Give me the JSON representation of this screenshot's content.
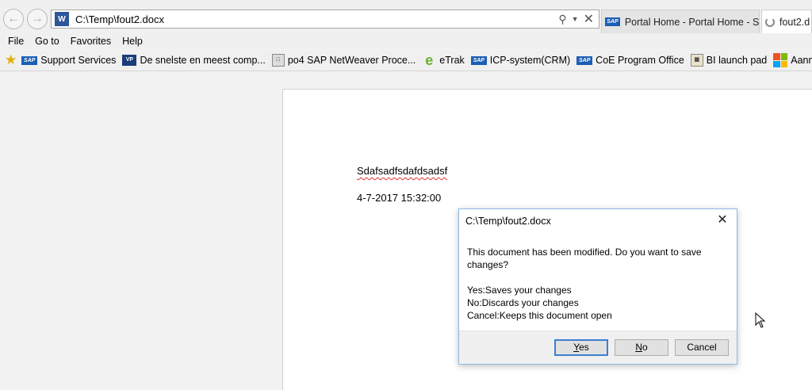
{
  "browser": {
    "address": "C:\\Temp\\fout2.docx",
    "address_icon": "W",
    "tabs": [
      {
        "label": "Portal Home - Portal Home - S...",
        "icon": "sap-logo-icon"
      },
      {
        "label": "fout2.d",
        "icon": "loading-spinner-icon"
      }
    ]
  },
  "menu": [
    "File",
    "Go to",
    "Favorites",
    "Help"
  ],
  "favorites": [
    {
      "label": "Support Services",
      "icon": "SAP"
    },
    {
      "label": "De snelste en meest comp...",
      "icon": "VP"
    },
    {
      "label": "po4 SAP NetWeaver Proce...",
      "icon": "page-icon"
    },
    {
      "label": "eTrak",
      "icon": "e"
    },
    {
      "label": "ICP-system(CRM)",
      "icon": "SAP"
    },
    {
      "label": "CoE Program Office",
      "icon": "SAP"
    },
    {
      "label": "BI launch pad",
      "icon": "bi-icon"
    },
    {
      "label": "Aanmelden bij je",
      "icon": "ms-icon"
    }
  ],
  "document": {
    "line1": "Sdafsadfsdafdsadsf",
    "line2": "4-7-2017 15:32:00"
  },
  "dialog": {
    "title": "C:\\Temp\\fout2.docx",
    "message": "This document has been modified. Do you want to save changes?",
    "options": [
      "Yes:Saves your changes",
      "No:Discards your changes",
      "Cancel:Keeps this document open"
    ],
    "buttons": {
      "yes_u": "Y",
      "yes_rest": "es",
      "no_u": "N",
      "no_rest": "o",
      "cancel": "Cancel"
    }
  },
  "colors": {
    "accent": "#3c7fd1",
    "dialog_border": "#8fb8e6",
    "sap_blue": "#1b5fb4",
    "word_blue": "#2b579a"
  }
}
